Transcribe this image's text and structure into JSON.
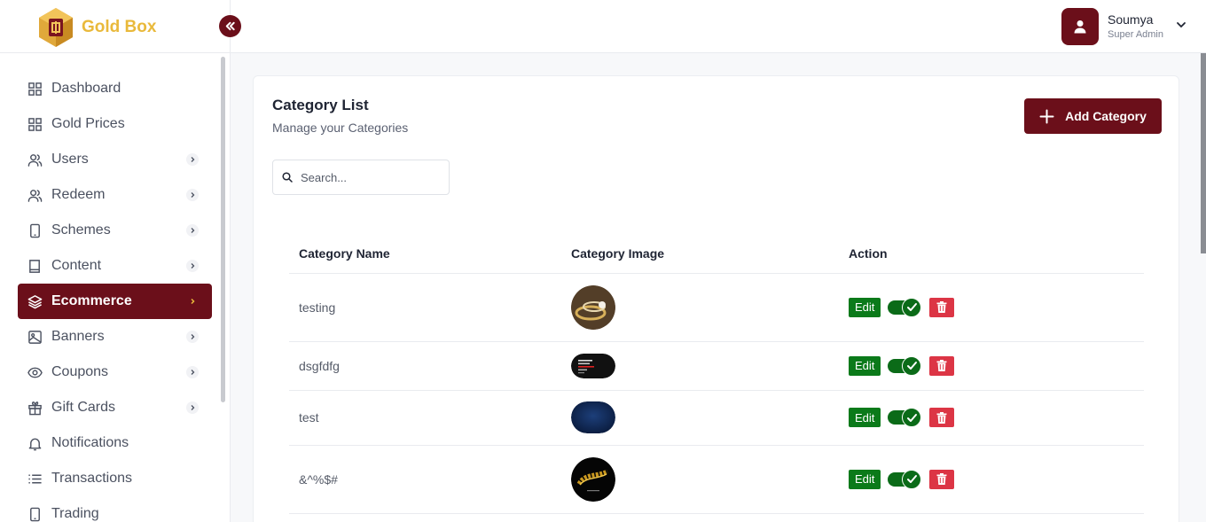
{
  "app": {
    "name": "Gold Box"
  },
  "sidebar": {
    "items": [
      {
        "label": "Dashboard",
        "icon": "grid-icon",
        "has_chevron": false,
        "active": false
      },
      {
        "label": "Gold Prices",
        "icon": "grid-icon",
        "has_chevron": false,
        "active": false
      },
      {
        "label": "Users",
        "icon": "users-icon",
        "has_chevron": true,
        "active": false
      },
      {
        "label": "Redeem",
        "icon": "users-icon",
        "has_chevron": true,
        "active": false
      },
      {
        "label": "Schemes",
        "icon": "phone-icon",
        "has_chevron": true,
        "active": false
      },
      {
        "label": "Content",
        "icon": "book-icon",
        "has_chevron": true,
        "active": false
      },
      {
        "label": "Ecommerce",
        "icon": "layers-icon",
        "has_chevron": true,
        "active": true
      },
      {
        "label": "Banners",
        "icon": "image-icon",
        "has_chevron": true,
        "active": false
      },
      {
        "label": "Coupons",
        "icon": "eye-icon",
        "has_chevron": true,
        "active": false
      },
      {
        "label": "Gift Cards",
        "icon": "gift-icon",
        "has_chevron": true,
        "active": false
      },
      {
        "label": "Notifications",
        "icon": "bell-icon",
        "has_chevron": false,
        "active": false
      },
      {
        "label": "Transactions",
        "icon": "list-icon",
        "has_chevron": false,
        "active": false
      },
      {
        "label": "Trading",
        "icon": "phone-icon",
        "has_chevron": false,
        "active": false
      }
    ]
  },
  "header": {
    "user_name": "Soumya",
    "user_role": "Super Admin"
  },
  "main": {
    "title": "Category List",
    "subtitle": "Manage your Categories",
    "add_button_label": "Add Category",
    "search": {
      "placeholder": "Search...",
      "value": ""
    },
    "table": {
      "columns": [
        "Category Name",
        "Category Image",
        "Action"
      ],
      "rows": [
        {
          "name": "testing",
          "image": "ring-photo",
          "edit_label": "Edit",
          "enabled": true
        },
        {
          "name": "dsgfdfg",
          "image": "dark-banner",
          "edit_label": "Edit",
          "enabled": true
        },
        {
          "name": "test",
          "image": "blue-gradient",
          "edit_label": "Edit",
          "enabled": true
        },
        {
          "name": "&^%$#",
          "image": "gold-chain",
          "edit_label": "Edit",
          "enabled": true
        }
      ]
    }
  },
  "colors": {
    "brand": "#6b0f1a",
    "logo": "#e9b93b",
    "edit": "#0b7a1a",
    "delete": "#dc3545"
  }
}
